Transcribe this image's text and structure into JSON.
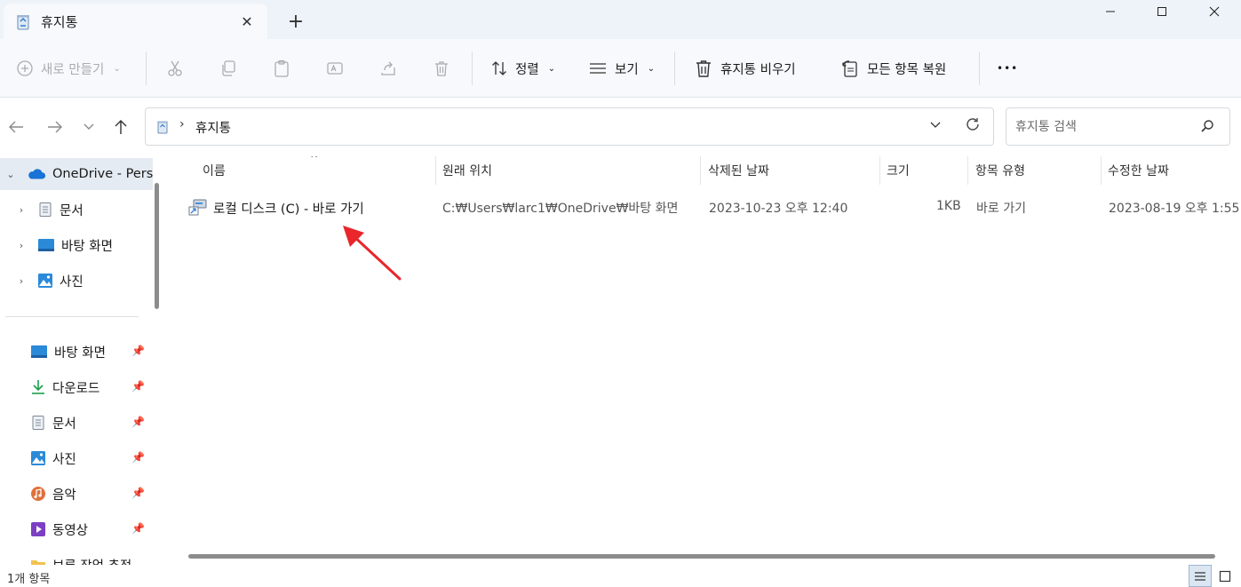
{
  "tab": {
    "title": "휴지통",
    "icon": "recycle-bin-icon",
    "close": "✕",
    "new_tab": "+"
  },
  "window": {
    "minimize": "—",
    "maximize": "☐",
    "close": "✕"
  },
  "toolbar": {
    "new_label": "새로 만들기",
    "sort_label": "정렬",
    "view_label": "보기",
    "empty_bin_label": "휴지통 비우기",
    "restore_all_label": "모든 항목 복원",
    "more_label": "•••"
  },
  "address": {
    "separator": "›",
    "path": "휴지통"
  },
  "search": {
    "placeholder": "휴지통 검색"
  },
  "sidebar": {
    "onedrive": "OneDrive - Pers",
    "tree": [
      {
        "label": "문서",
        "icon": "document-icon"
      },
      {
        "label": "바탕 화면",
        "icon": "desktop-icon"
      },
      {
        "label": "사진",
        "icon": "pictures-icon"
      }
    ],
    "quick": [
      {
        "label": "바탕 화면",
        "icon": "desktop-icon"
      },
      {
        "label": "다운로드",
        "icon": "download-icon"
      },
      {
        "label": "문서",
        "icon": "document-icon"
      },
      {
        "label": "사진",
        "icon": "pictures-icon"
      },
      {
        "label": "음악",
        "icon": "music-icon"
      },
      {
        "label": "동영상",
        "icon": "video-icon"
      },
      {
        "label": "보류 작업 추적",
        "icon": "folder-icon"
      }
    ]
  },
  "columns": {
    "name": "이름",
    "original_location": "원래 위치",
    "deleted_date": "삭제된 날짜",
    "size": "크기",
    "item_type": "항목 유형",
    "modified_date": "수정한 날짜"
  },
  "files": [
    {
      "name": "로컬 디스크 (C) - 바로 가기",
      "original_location": "C:₩Users₩larc1₩OneDrive₩바탕 화면",
      "deleted_date": "2023-10-23 오후 12:40",
      "size": "1KB",
      "item_type": "바로 가기",
      "modified_date": "2023-08-19 오후 1:55"
    }
  ],
  "status": {
    "count": "1개 항목"
  },
  "colors": {
    "accent": "#0067c0",
    "annotation_arrow": "#e8262b",
    "titlebar_bg": "#eef3f9",
    "toolbar_bg": "#f7f9fc"
  }
}
